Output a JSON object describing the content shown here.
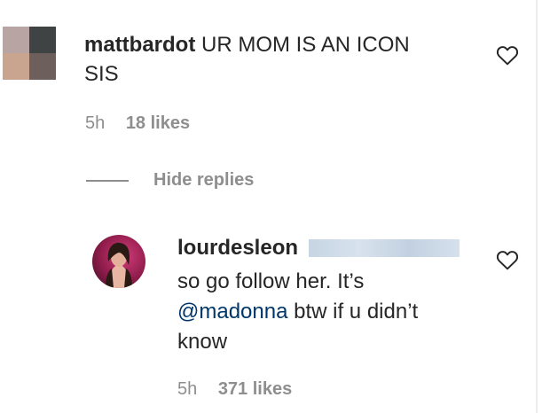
{
  "comment": {
    "username": "mattbardot",
    "text_line1": "UR MOM IS AN ICON",
    "text_line2": "SIS",
    "time": "5h",
    "likes": "18 likes"
  },
  "hide_replies_label": "Hide replies",
  "reply": {
    "username": "lourdesleon",
    "text_line1": "so go follow her. It’s",
    "mention": "@madonna",
    "text_line2_rest": " btw if u didn’t",
    "text_line3": "know",
    "time": "5h",
    "likes": "371 likes"
  },
  "icons": {
    "comment_like": "heart-outline-icon",
    "reply_like": "heart-outline-icon"
  },
  "colors": {
    "text": "#262626",
    "muted": "#8e8e8e",
    "mention": "#00376b"
  }
}
